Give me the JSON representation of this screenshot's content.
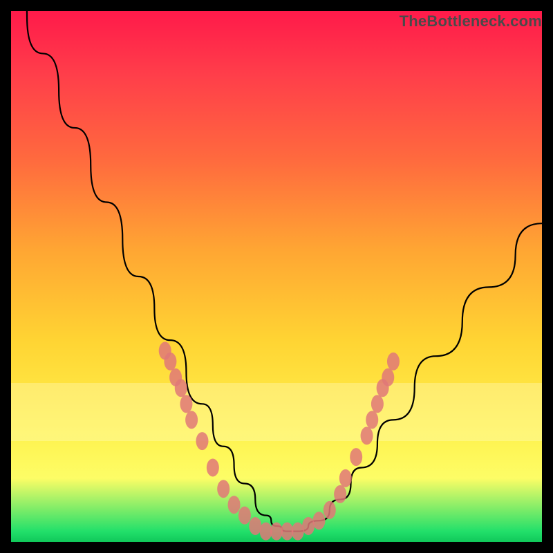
{
  "watermark": "TheBottleneck.com",
  "chart_data": {
    "type": "line",
    "title": "",
    "xlabel": "",
    "ylabel": "",
    "xlim": [
      0,
      100
    ],
    "ylim": [
      0,
      100
    ],
    "series": [
      {
        "name": "bottleneck-curve",
        "x": [
          0,
          6,
          12,
          18,
          24,
          30,
          36,
          40,
          44,
          48,
          50,
          52,
          54,
          58,
          62,
          66,
          72,
          80,
          90,
          100
        ],
        "values": [
          106,
          92,
          78,
          64,
          50,
          38,
          26,
          18,
          11,
          5,
          3,
          2,
          2,
          4,
          8,
          14,
          23,
          35,
          48,
          60
        ]
      }
    ],
    "highlight_bands": [
      {
        "y_from": 19,
        "y_to": 30,
        "alpha": 0.55
      }
    ],
    "scatter": {
      "name": "data-points",
      "color": "#e07878",
      "points": [
        {
          "x": 29,
          "y": 36
        },
        {
          "x": 30,
          "y": 34
        },
        {
          "x": 31,
          "y": 31
        },
        {
          "x": 32,
          "y": 29
        },
        {
          "x": 33,
          "y": 26
        },
        {
          "x": 34,
          "y": 23
        },
        {
          "x": 36,
          "y": 19
        },
        {
          "x": 38,
          "y": 14
        },
        {
          "x": 40,
          "y": 10
        },
        {
          "x": 42,
          "y": 7
        },
        {
          "x": 44,
          "y": 5
        },
        {
          "x": 46,
          "y": 3
        },
        {
          "x": 48,
          "y": 2
        },
        {
          "x": 50,
          "y": 2
        },
        {
          "x": 52,
          "y": 2
        },
        {
          "x": 54,
          "y": 2
        },
        {
          "x": 56,
          "y": 3
        },
        {
          "x": 58,
          "y": 4
        },
        {
          "x": 60,
          "y": 6
        },
        {
          "x": 62,
          "y": 9
        },
        {
          "x": 63,
          "y": 12
        },
        {
          "x": 65,
          "y": 16
        },
        {
          "x": 67,
          "y": 20
        },
        {
          "x": 68,
          "y": 23
        },
        {
          "x": 69,
          "y": 26
        },
        {
          "x": 70,
          "y": 29
        },
        {
          "x": 71,
          "y": 31
        },
        {
          "x": 72,
          "y": 34
        }
      ]
    }
  }
}
